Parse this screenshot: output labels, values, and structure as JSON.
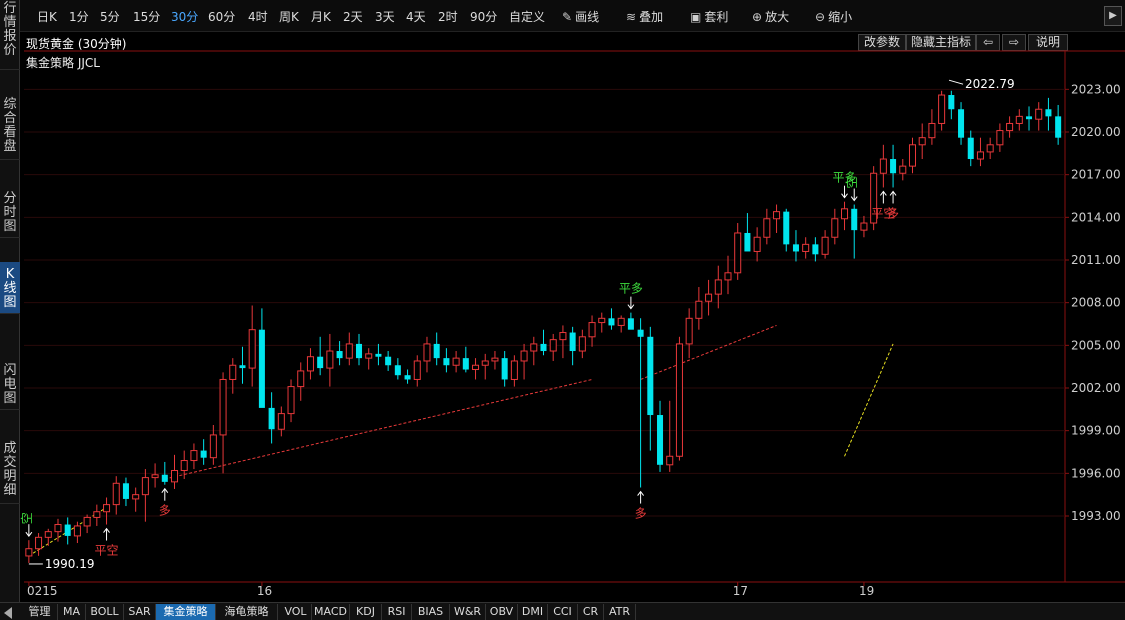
{
  "left_tabs": [
    {
      "label": "行情报价",
      "active": false
    },
    {
      "label": "综合看盘",
      "active": false
    },
    {
      "label": "分时图",
      "active": false
    },
    {
      "label": "K线图",
      "active": true
    },
    {
      "label": "闪电图",
      "active": false
    },
    {
      "label": "成交明细",
      "active": false
    }
  ],
  "toolbar": {
    "periods": [
      "日K",
      "1分",
      "5分",
      "15分",
      "30分",
      "60分",
      "4时",
      "周K",
      "月K",
      "2天",
      "3天",
      "4天",
      "2时",
      "90分",
      "自定义"
    ],
    "active_period": "30分",
    "tools": [
      {
        "label": "画线",
        "icon": "pencil-icon"
      },
      {
        "label": "叠加",
        "icon": "stack-icon"
      },
      {
        "label": "套利",
        "icon": "briefcase-icon"
      },
      {
        "label": "放大",
        "icon": "zoom-in-icon"
      },
      {
        "label": "缩小",
        "icon": "zoom-out-icon"
      }
    ],
    "collapse_label": "▶"
  },
  "header": {
    "title": "现货黄金 (30分钟)",
    "buttons": {
      "params": "改参数",
      "hide": "隐藏主指标",
      "prev": "⇦",
      "next": "⇨",
      "help": "说明"
    },
    "strategy": "集金策略 JJCL"
  },
  "chart_data": {
    "type": "candlestick",
    "instrument": "现货黄金",
    "interval": "30分钟",
    "y_ticks": [
      "2023.00",
      "2020.00",
      "2017.00",
      "2014.00",
      "2011.00",
      "2008.00",
      "2005.00",
      "2002.00",
      "1999.00",
      "1996.00",
      "1993.00"
    ],
    "ylim": [
      1988.5,
      2024.5
    ],
    "x_labels": [
      {
        "text": "0215",
        "bar": 0
      },
      {
        "text": "16",
        "bar": 24
      },
      {
        "text": "17",
        "bar": 73
      },
      {
        "text": "19",
        "bar": 86
      }
    ],
    "candles": [
      [
        1990.19,
        1991.3,
        1989.7,
        1990.7
      ],
      [
        1990.7,
        1991.8,
        1990.2,
        1991.5
      ],
      [
        1991.5,
        1992.1,
        1990.9,
        1991.9
      ],
      [
        1991.9,
        1992.8,
        1991.2,
        1992.4
      ],
      [
        1992.4,
        1992.9,
        1991.0,
        1991.6
      ],
      [
        1991.6,
        1992.6,
        1991.1,
        1992.3
      ],
      [
        1992.3,
        1993.1,
        1991.8,
        1992.9
      ],
      [
        1992.9,
        1993.8,
        1992.3,
        1993.3
      ],
      [
        1993.3,
        1994.3,
        1992.4,
        1993.8
      ],
      [
        1993.8,
        1995.8,
        1993.1,
        1995.3
      ],
      [
        1995.3,
        1995.7,
        1993.7,
        1994.2
      ],
      [
        1994.2,
        1995.0,
        1993.3,
        1994.5
      ],
      [
        1994.5,
        1996.3,
        1992.6,
        1995.7
      ],
      [
        1995.7,
        1996.7,
        1995.0,
        1995.9
      ],
      [
        1995.9,
        1996.8,
        1995.2,
        1995.4
      ],
      [
        1995.4,
        1997.3,
        1994.9,
        1996.2
      ],
      [
        1996.2,
        1997.6,
        1995.6,
        1996.9
      ],
      [
        1996.9,
        1998.1,
        1996.3,
        1997.6
      ],
      [
        1997.6,
        1998.4,
        1996.6,
        1997.1
      ],
      [
        1997.1,
        1999.4,
        1996.6,
        1998.7
      ],
      [
        1998.7,
        2003.1,
        1996.0,
        2002.6
      ],
      [
        2002.6,
        2004.1,
        2001.6,
        2003.6
      ],
      [
        2003.6,
        2004.9,
        2002.3,
        2003.4
      ],
      [
        2003.4,
        2007.8,
        2002.1,
        2006.1
      ],
      [
        2006.1,
        2007.6,
        2001.8,
        2000.6
      ],
      [
        2000.6,
        2001.7,
        1998.1,
        1999.1
      ],
      [
        1999.1,
        2000.7,
        1998.6,
        2000.2
      ],
      [
        2000.2,
        2002.6,
        1999.6,
        2002.1
      ],
      [
        2002.1,
        2003.8,
        2001.1,
        2003.2
      ],
      [
        2003.2,
        2004.8,
        2002.6,
        2004.2
      ],
      [
        2004.2,
        2005.6,
        2002.9,
        2003.4
      ],
      [
        2003.4,
        2005.8,
        2002.1,
        2004.6
      ],
      [
        2004.6,
        2005.3,
        2003.6,
        2004.1
      ],
      [
        2004.1,
        2005.9,
        2003.6,
        2005.1
      ],
      [
        2005.1,
        2005.8,
        2003.6,
        2004.1
      ],
      [
        2004.1,
        2004.8,
        2003.3,
        2004.4
      ],
      [
        2004.4,
        2005.1,
        2003.6,
        2004.2
      ],
      [
        2004.2,
        2004.6,
        2003.2,
        2003.6
      ],
      [
        2003.6,
        2004.1,
        2002.6,
        2002.9
      ],
      [
        2002.9,
        2003.3,
        2002.3,
        2002.6
      ],
      [
        2002.6,
        2004.3,
        2002.1,
        2003.9
      ],
      [
        2003.9,
        2005.6,
        2003.1,
        2005.1
      ],
      [
        2005.1,
        2005.9,
        2003.6,
        2004.1
      ],
      [
        2004.1,
        2004.8,
        2003.1,
        2003.6
      ],
      [
        2003.6,
        2004.6,
        2003.1,
        2004.1
      ],
      [
        2004.1,
        2004.9,
        2003.1,
        2003.3
      ],
      [
        2003.3,
        2004.1,
        2002.6,
        2003.6
      ],
      [
        2003.6,
        2004.4,
        2002.6,
        2003.9
      ],
      [
        2003.9,
        2004.6,
        2003.3,
        2004.1
      ],
      [
        2004.1,
        2004.6,
        2002.1,
        2002.6
      ],
      [
        2002.6,
        2004.3,
        2002.1,
        2003.9
      ],
      [
        2003.9,
        2005.1,
        2002.6,
        2004.6
      ],
      [
        2004.6,
        2005.6,
        2003.6,
        2005.1
      ],
      [
        2005.1,
        2006.1,
        2004.3,
        2004.6
      ],
      [
        2004.6,
        2005.8,
        2003.9,
        2005.4
      ],
      [
        2005.4,
        2006.4,
        2004.1,
        2005.9
      ],
      [
        2005.9,
        2006.3,
        2003.6,
        2004.6
      ],
      [
        2004.6,
        2006.1,
        2004.1,
        2005.6
      ],
      [
        2005.6,
        2007.1,
        2004.9,
        2006.6
      ],
      [
        2006.6,
        2007.3,
        2005.9,
        2006.9
      ],
      [
        2006.9,
        2007.6,
        2006.1,
        2006.4
      ],
      [
        2006.4,
        2007.1,
        2005.9,
        2006.9
      ],
      [
        2006.9,
        2007.3,
        2006.3,
        2006.1
      ],
      [
        2006.1,
        2006.9,
        1995.0,
        2005.6
      ],
      [
        2005.6,
        2006.3,
        1997.6,
        2000.1
      ],
      [
        2000.1,
        2001.1,
        1996.1,
        1996.6
      ],
      [
        1996.6,
        2001.1,
        1996.1,
        1997.2
      ],
      [
        1997.2,
        2005.6,
        1996.9,
        2005.1
      ],
      [
        2005.1,
        2007.6,
        2004.1,
        2006.9
      ],
      [
        2006.9,
        2009.1,
        2006.1,
        2008.1
      ],
      [
        2008.1,
        2009.6,
        2007.1,
        2008.6
      ],
      [
        2008.6,
        2010.6,
        2007.6,
        2009.6
      ],
      [
        2009.6,
        2011.3,
        2008.6,
        2010.1
      ],
      [
        2010.1,
        2013.6,
        2009.6,
        2012.9
      ],
      [
        2012.9,
        2014.3,
        2011.9,
        2011.6
      ],
      [
        2011.6,
        2013.3,
        2010.9,
        2012.6
      ],
      [
        2012.6,
        2014.6,
        2012.1,
        2013.9
      ],
      [
        2013.9,
        2014.9,
        2012.9,
        2014.4
      ],
      [
        2014.4,
        2014.6,
        2011.6,
        2012.1
      ],
      [
        2012.1,
        2013.1,
        2010.9,
        2011.6
      ],
      [
        2011.6,
        2012.6,
        2011.1,
        2012.1
      ],
      [
        2012.1,
        2012.6,
        2010.9,
        2011.4
      ],
      [
        2011.4,
        2013.1,
        2011.1,
        2012.6
      ],
      [
        2012.6,
        2014.6,
        2012.1,
        2013.9
      ],
      [
        2013.9,
        2015.1,
        2013.1,
        2014.6
      ],
      [
        2014.6,
        2014.9,
        2011.1,
        2013.1
      ],
      [
        2013.1,
        2014.1,
        2012.6,
        2013.6
      ],
      [
        2013.6,
        2017.6,
        2013.1,
        2017.1
      ],
      [
        2017.1,
        2019.1,
        2016.1,
        2018.1
      ],
      [
        2018.1,
        2019.1,
        2016.1,
        2017.1
      ],
      [
        2017.1,
        2018.1,
        2016.6,
        2017.6
      ],
      [
        2017.6,
        2019.6,
        2017.1,
        2019.1
      ],
      [
        2019.1,
        2020.6,
        2018.1,
        2019.6
      ],
      [
        2019.6,
        2021.6,
        2019.1,
        2020.6
      ],
      [
        2020.6,
        2022.9,
        2020.1,
        2022.6
      ],
      [
        2022.6,
        2022.9,
        2020.9,
        2021.6
      ],
      [
        2021.6,
        2022.1,
        2019.1,
        2019.6
      ],
      [
        2019.6,
        2020.1,
        2017.6,
        2018.1
      ],
      [
        2018.1,
        2019.6,
        2017.6,
        2018.6
      ],
      [
        2018.6,
        2019.6,
        2018.1,
        2019.1
      ],
      [
        2019.1,
        2020.6,
        2018.6,
        2020.1
      ],
      [
        2020.1,
        2021.1,
        2019.6,
        2020.6
      ],
      [
        2020.6,
        2021.6,
        2020.1,
        2021.1
      ],
      [
        2021.1,
        2021.8,
        2020.1,
        2020.9
      ],
      [
        2020.9,
        2022.1,
        2020.1,
        2021.6
      ],
      [
        2021.6,
        2022.4,
        2020.1,
        2021.1
      ],
      [
        2021.1,
        2021.9,
        2019.1,
        2019.6
      ]
    ],
    "price_labels": [
      {
        "text": "1990.19",
        "bar": 0,
        "price": 1990.19,
        "side": "right",
        "pos": "below"
      },
      {
        "text": "2022.79",
        "bar": 96,
        "price": 2022.8,
        "side": "right",
        "pos": "above"
      }
    ],
    "signals": [
      {
        "text": "空",
        "bar": 0,
        "color": "#3ddc3d",
        "vertical": true,
        "arrow": "down",
        "pos": "above"
      },
      {
        "text": "平空",
        "bar": 8,
        "color": "#e83a3a",
        "arrow": "up",
        "pos": "below"
      },
      {
        "text": "多",
        "bar": 14,
        "color": "#e83a3a",
        "arrow": "up",
        "pos": "below"
      },
      {
        "text": "平多",
        "bar": 62,
        "color": "#3ddc3d",
        "arrow": "down",
        "pos": "above"
      },
      {
        "text": "多",
        "bar": 63,
        "color": "#e83a3a",
        "arrow": "up",
        "pos": "below"
      },
      {
        "text": "平多",
        "bar": 84,
        "color": "#3ddc3d",
        "arrow": "down",
        "pos": "above"
      },
      {
        "text": "空",
        "bar": 85,
        "color": "#3ddc3d",
        "vertical": true,
        "arrow": "down",
        "pos": "above"
      },
      {
        "text": "平空",
        "bar": 88,
        "color": "#e83a3a",
        "arrow": "up",
        "pos": "below"
      },
      {
        "text": "多",
        "bar": 89,
        "color": "#e83a3a",
        "arrow": "up",
        "pos": "below"
      }
    ],
    "trend_lines": [
      {
        "from": [
          0,
          1990.2
        ],
        "to": [
          8,
          1993.6
        ],
        "color": "#e8e020"
      },
      {
        "from": [
          14,
          1995.6
        ],
        "to": [
          58,
          2002.6
        ],
        "color": "#e83a3a"
      },
      {
        "from": [
          63,
          2002.6
        ],
        "to": [
          77,
          2006.4
        ],
        "color": "#e83a3a"
      },
      {
        "from": [
          84,
          1997.2
        ],
        "to": [
          89,
          2005.1
        ],
        "color": "#e8e020"
      }
    ],
    "grid": true,
    "up_color": "#e8383a",
    "down_color": "#00e5ee"
  },
  "bottom_tabs": [
    {
      "label": "管理",
      "active": false
    },
    {
      "label": "MA",
      "active": false
    },
    {
      "label": "BOLL",
      "active": false
    },
    {
      "label": "SAR",
      "active": false
    },
    {
      "label": "集金策略",
      "active": true
    },
    {
      "label": "海龟策略",
      "active": false
    },
    {
      "label": "VOL",
      "active": false
    },
    {
      "label": "MACD",
      "active": false
    },
    {
      "label": "KDJ",
      "active": false
    },
    {
      "label": "RSI",
      "active": false
    },
    {
      "label": "BIAS",
      "active": false
    },
    {
      "label": "W&R",
      "active": false
    },
    {
      "label": "OBV",
      "active": false
    },
    {
      "label": "DMI",
      "active": false
    },
    {
      "label": "CCI",
      "active": false
    },
    {
      "label": "CR",
      "active": false
    },
    {
      "label": "ATR",
      "active": false
    }
  ]
}
